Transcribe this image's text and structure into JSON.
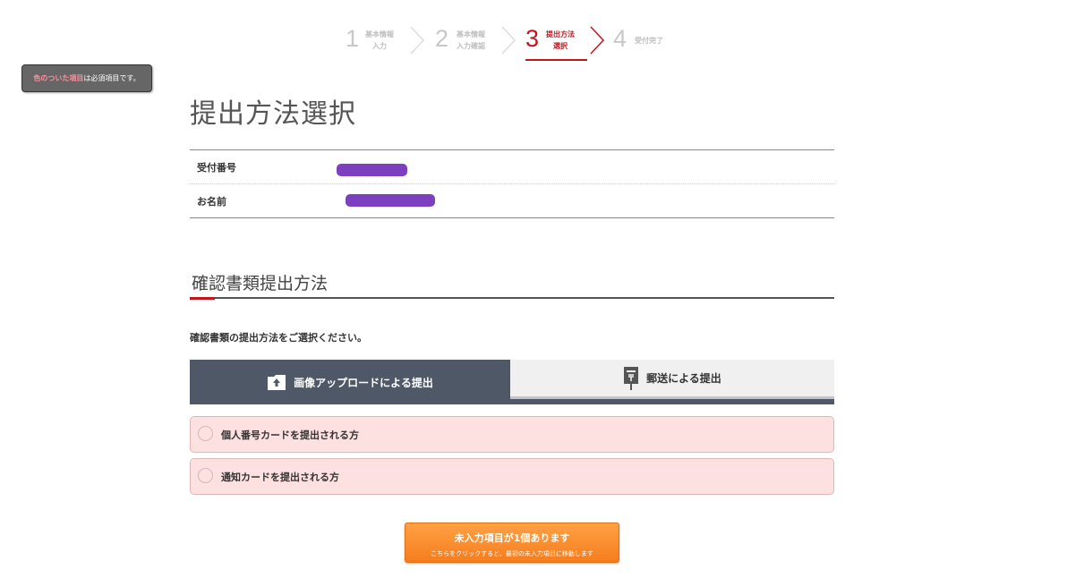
{
  "stepper": {
    "steps": [
      {
        "number": "1",
        "label_line1": "基本情報",
        "label_line2": "入力",
        "state": "done"
      },
      {
        "number": "2",
        "label_line1": "基本情報",
        "label_line2": "入力確認",
        "state": "done"
      },
      {
        "number": "3",
        "label_line1": "提出方法",
        "label_line2": "選択",
        "state": "active"
      },
      {
        "number": "4",
        "label_line1": "受付完了",
        "label_line2": "",
        "state": "pending"
      }
    ]
  },
  "required_note": {
    "highlight": "色のついた項目",
    "rest": "は必須項目です。"
  },
  "page_title": "提出方法選択",
  "info": {
    "rows": [
      {
        "label": "受付番号",
        "value_redacted": true
      },
      {
        "label": "お名前",
        "value_redacted": true
      }
    ]
  },
  "section": {
    "title": "確認書類提出方法",
    "instruction": "確認書類の提出方法をご選択ください。"
  },
  "tabs": [
    {
      "label": "画像アップロードによる提出",
      "icon": "upload-folder-icon",
      "selected": true
    },
    {
      "label": "郵送による提出",
      "icon": "postbox-icon",
      "selected": false
    }
  ],
  "options": [
    {
      "label": "個人番号カードを提出される方",
      "checked": false
    },
    {
      "label": "通知カードを提出される方",
      "checked": false
    }
  ],
  "submit": {
    "main": "未入力項目が1個あります",
    "sub": "こちらをクリックすると、最初の未入力項目に移動します"
  },
  "colors": {
    "accent_red": "#c4151c",
    "tab_active_bg": "#4f5866",
    "option_bg": "#fde0e0",
    "button_orange": "#f78a2a",
    "redaction": "#7b3fbf"
  }
}
